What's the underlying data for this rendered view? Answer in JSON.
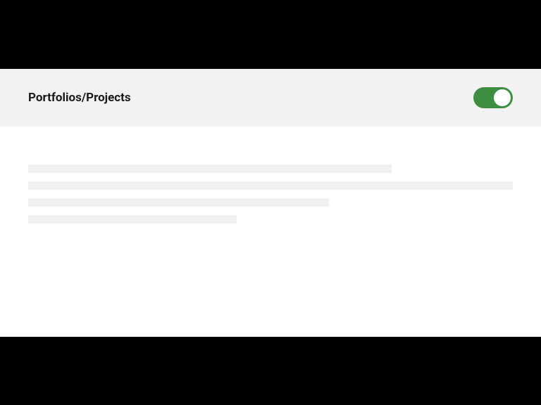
{
  "section": {
    "title": "Portfolios/Projects",
    "toggle_on": true
  }
}
